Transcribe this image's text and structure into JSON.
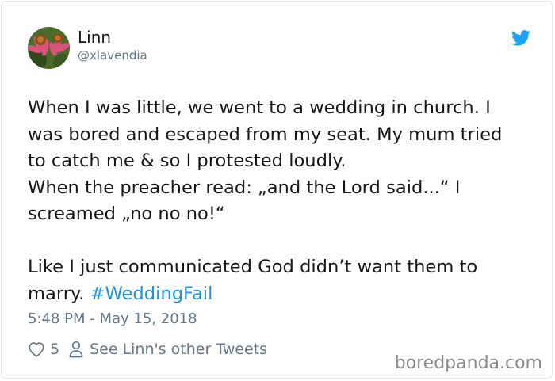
{
  "user": {
    "display_name": "Linn",
    "handle": "@xlavendia"
  },
  "icons": {
    "avatar": "avatar-coneflower-photo",
    "brand": "twitter-bird-icon",
    "like": "heart-outline-icon",
    "profile": "person-outline-icon"
  },
  "tweet": {
    "lines": [
      "When I was little, we went to a wedding in church. I",
      "was bored and escaped from my seat. My mum tried",
      "to catch me & so I protested loudly.",
      "When the preacher read: „and the Lord said...“ I",
      "screamed „no no no!“",
      "Like I just communicated God didn’t want them to",
      "marry."
    ],
    "hashtag": "#WeddingFail",
    "timestamp": "5:48 PM - May 15, 2018"
  },
  "actions": {
    "like_count": "5",
    "profile_link": "See Linn's other Tweets"
  },
  "watermark": "boredpanda.com",
  "colors": {
    "link": "#1b95e0",
    "twitter_blue": "#1da1f2",
    "secondary_text": "#657786",
    "border": "#e1e8ed"
  }
}
